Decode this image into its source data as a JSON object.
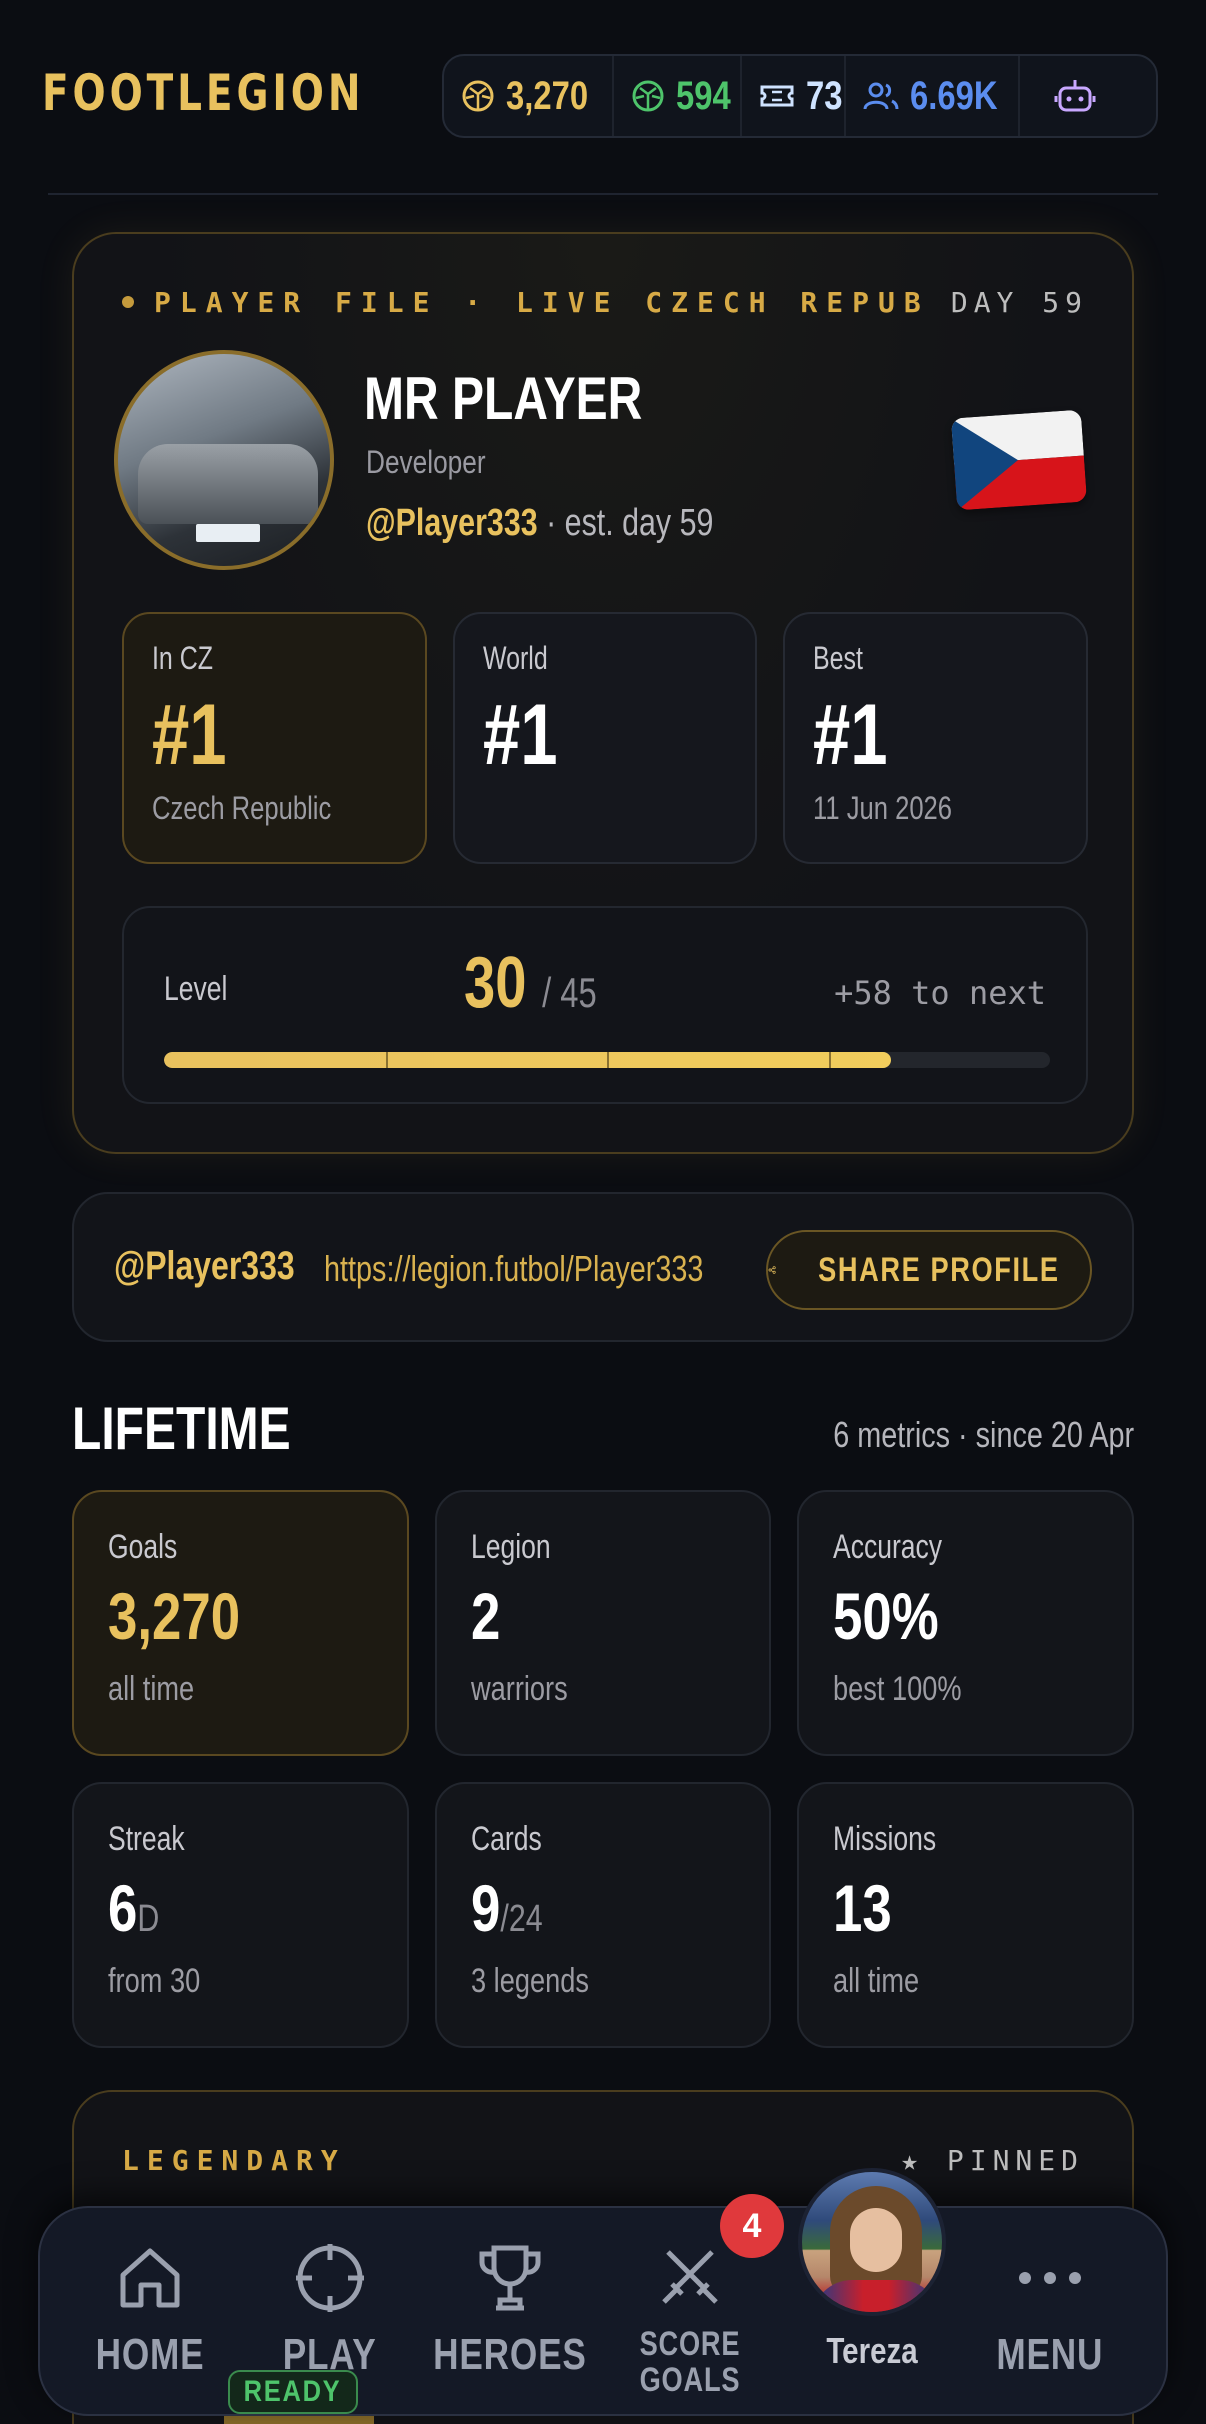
{
  "header": {
    "logo": "FOOTLEGION",
    "stats": [
      {
        "icon": "ball-gold-icon",
        "value": "3,270",
        "color": "#e8c15e"
      },
      {
        "icon": "ball-green-icon",
        "value": "594",
        "color": "#4ec46b"
      },
      {
        "icon": "ticket-icon",
        "value": "73",
        "color": "#cfe3ff"
      },
      {
        "icon": "users-icon",
        "value": "6.69K",
        "color": "#5b8def"
      },
      {
        "icon": "robot-icon",
        "value": "",
        "color": "#c9a8ff"
      }
    ]
  },
  "player_card": {
    "file_label": "PLAYER FILE · LIVE CZECH REPUBLI",
    "day": "DAY 59",
    "name": "MR PLAYER",
    "role": "Developer",
    "handle": "@Player333",
    "est": " · est. day 59",
    "flag": "czech-flag-icon",
    "ranks": [
      {
        "label": "In CZ",
        "value": "#1",
        "sub": "Czech Republic"
      },
      {
        "label": "World",
        "value": "#1",
        "sub": ""
      },
      {
        "label": "Best",
        "value": "#1",
        "sub": "11 Jun 2026"
      }
    ],
    "level": {
      "label": "Level",
      "current": "30",
      "max": "/ 45",
      "next": "+58 to next",
      "progress": 0.82
    }
  },
  "share": {
    "handle": "@Player333",
    "url": "https://legion.futbol/Player333",
    "button": "SHARE PROFILE"
  },
  "lifetime": {
    "title": "LIFETIME",
    "meta": "6 metrics · since 20 Apr",
    "metrics": [
      {
        "label": "Goals",
        "value": "3,270",
        "unit": "",
        "sub": "all time"
      },
      {
        "label": "Legion",
        "value": "2",
        "unit": "",
        "sub": "warriors"
      },
      {
        "label": "Accuracy",
        "value": "50%",
        "unit": "",
        "sub": "best 100%"
      },
      {
        "label": "Streak",
        "value": "6",
        "unit": "D",
        "sub": "from 30"
      },
      {
        "label": "Cards",
        "value": "9",
        "unit": "/24",
        "sub": "3 legends"
      },
      {
        "label": "Missions",
        "value": "13",
        "unit": "",
        "sub": "all time"
      }
    ]
  },
  "legendary": {
    "title": "LEGENDARY",
    "pinned": "★ PINNED"
  },
  "nav": {
    "home": "HOME",
    "play": "PLAY",
    "ready": "READY",
    "heroes": "HEROES",
    "score_goals": "SCORE GOALS",
    "score_line1": "SCORE",
    "score_line2": "GOALS",
    "badge": "4",
    "tereza": "Tereza",
    "menu": "MENU"
  }
}
